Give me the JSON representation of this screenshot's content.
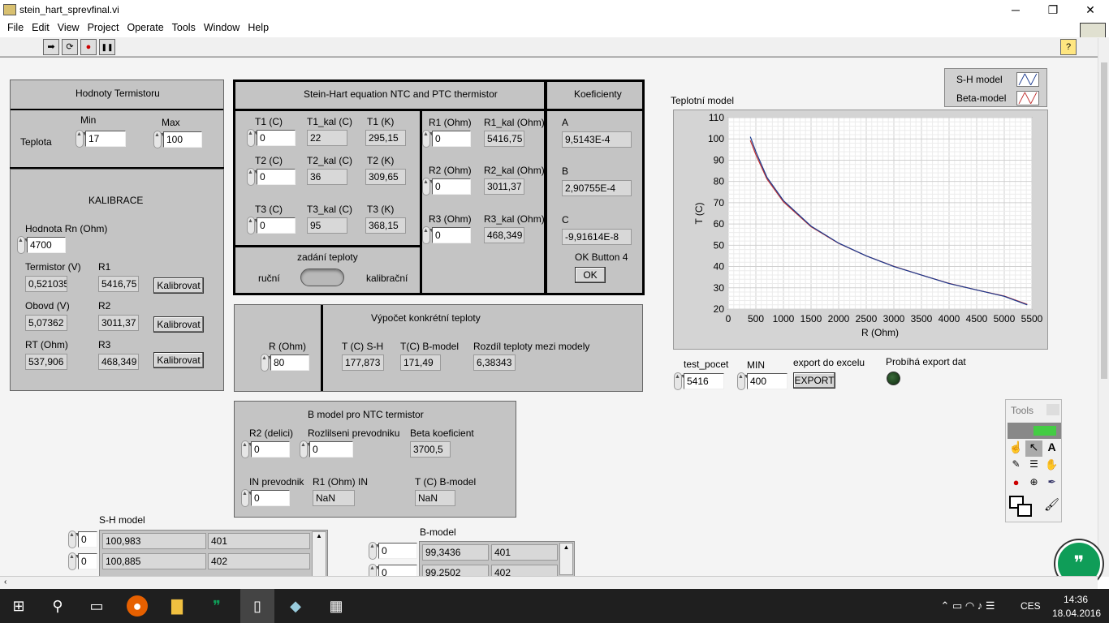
{
  "window": {
    "title": "stein_hart_sprevfinal.vi",
    "min": "─",
    "max": "❐",
    "close": "✕"
  },
  "menu": [
    "File",
    "Edit",
    "View",
    "Project",
    "Operate",
    "Tools",
    "Window",
    "Help"
  ],
  "toolbar": {
    "run": "➡",
    "run_cont": "⟳",
    "abort": "●",
    "pause": "❚❚",
    "help": "?"
  },
  "termistor": {
    "title": "Hodnoty Termistoru",
    "min_label": "Min",
    "max_label": "Max",
    "teplota_label": "Teplota",
    "min": "17",
    "max": "100"
  },
  "kalibrace": {
    "title": "KALIBRACE",
    "rn_label": "Hodnota Rn (Ohm)",
    "rn": "4700",
    "rows": [
      {
        "l1": "Termistor (V)",
        "v1": "0,521035",
        "l2": "R1",
        "v2": "5416,75",
        "btn": "Kalibrovat"
      },
      {
        "l1": "Obovd (V)",
        "v1": "5,07362",
        "l2": "R2",
        "v2": "3011,37",
        "btn": "Kalibrovat"
      },
      {
        "l1": "RT (Ohm)",
        "v1": "537,906",
        "l2": "R3",
        "v2": "468,349",
        "btn": "Kalibrovat"
      }
    ]
  },
  "stein": {
    "title": "Stein-Hart equation NTC and PTC thermistor",
    "rows": [
      {
        "tl": "T1 (C)",
        "tv": "0",
        "kl": "T1_kal (C)",
        "kv": "22",
        "ql": "T1 (K)",
        "qv": "295,15",
        "rl": "R1 (Ohm)",
        "rv": "0",
        "sl": "R1_kal (Ohm)",
        "sv": "5416,75"
      },
      {
        "tl": "T2 (C)",
        "tv": "0",
        "kl": "T2_kal (C)",
        "kv": "36",
        "ql": "T2 (K)",
        "qv": "309,65",
        "rl": "R2 (Ohm)",
        "rv": "0",
        "sl": "R2_kal (Ohm)",
        "sv": "3011,37"
      },
      {
        "tl": "T3 (C)",
        "tv": "0",
        "kl": "T3_kal (C)",
        "kv": "95",
        "ql": "T3 (K)",
        "qv": "368,15",
        "rl": "R3  (Ohm)",
        "rv": "0",
        "sl": "R3_kal (Ohm)",
        "sv": "468,349"
      }
    ],
    "zadani": "zadání teploty",
    "rucni": "ruční",
    "kalibracni": "kalibrační"
  },
  "koef": {
    "title": "Koeficienty",
    "a_label": "A",
    "a": "9,5143E-4",
    "b_label": "B",
    "b": "2,90755E-4",
    "c_label": "C",
    "c": "-9,91614E-8",
    "ok_label": "OK Button 4",
    "ok": "OK"
  },
  "vypocet": {
    "title": "Výpočet konkrétní teploty",
    "r_label": "R (Ohm)",
    "r": "80",
    "sh_label": "T (C) S-H",
    "sh": "177,873",
    "b_label": "T(C) B-model",
    "b": "171,49",
    "diff_label": "Rozdíl teploty mezi modely",
    "diff": "6,38343"
  },
  "bmodel": {
    "title": "B model pro NTC termistor",
    "r2_label": "R2 (delici)",
    "r2": "0",
    "rozl_label": "Rozlilseni prevodniku",
    "rozl": "0",
    "beta_label": "Beta koeficient",
    "beta": "3700,5",
    "in_label": "IN prevodnik",
    "in": "0",
    "r1in_label": "R1 (Ohm) IN",
    "r1in": "NaN",
    "tb_label": "T (C) B-model",
    "tb": "NaN"
  },
  "arrays": {
    "sh_label": "S-H model",
    "sh_idx": [
      "0",
      "0"
    ],
    "sh_rows": [
      [
        "100,983",
        "401"
      ],
      [
        "100,885",
        "402"
      ]
    ],
    "b_label": "B-model",
    "b_idx": [
      "0",
      "0"
    ],
    "b_rows": [
      [
        "99,3436",
        "401"
      ],
      [
        "99,2502",
        "402"
      ]
    ]
  },
  "export": {
    "test_label": "test_pocet",
    "test": "5416",
    "min_label": "MIN",
    "min": "400",
    "exp_label": "export  do excelu",
    "exp_btn": "EXPORT",
    "status_label": "Probíhá export dat"
  },
  "tools": {
    "title": "Tools"
  },
  "legend": [
    {
      "name": "S-H model"
    },
    {
      "name": "Beta-model"
    }
  ],
  "chart_data": {
    "type": "line",
    "title": "Teplotní model",
    "xlabel": "R (Ohm)",
    "ylabel": "T (C)",
    "xlim": [
      0,
      5500
    ],
    "ylim": [
      20,
      110
    ],
    "xticks": [
      "0",
      "500",
      "1000",
      "1500",
      "2000",
      "2500",
      "3000",
      "3500",
      "4000",
      "4500",
      "5000",
      "5500"
    ],
    "yticks": [
      "20",
      "30",
      "40",
      "50",
      "60",
      "70",
      "80",
      "90",
      "100",
      "110"
    ],
    "grid": true,
    "colors": {
      "sh": "#1a3a8f",
      "beta": "#c03030"
    },
    "series": [
      {
        "name": "S-H model",
        "x": [
          400,
          500,
          700,
          1000,
          1500,
          2000,
          2500,
          3000,
          3500,
          4000,
          4500,
          5000,
          5416
        ],
        "y": [
          101,
          94,
          82,
          71,
          59,
          51,
          45,
          40,
          36,
          32,
          29,
          26,
          22
        ]
      },
      {
        "name": "Beta-model",
        "x": [
          400,
          500,
          700,
          1000,
          1500,
          2000,
          2500,
          3000,
          3500,
          4000,
          4500,
          5000,
          5416
        ],
        "y": [
          99.3,
          92.6,
          81.2,
          70.4,
          58.7,
          50.9,
          45.0,
          40.1,
          36.0,
          32.1,
          29.0,
          26.1,
          22.2
        ]
      }
    ]
  },
  "taskbar": {
    "time": "14:36",
    "date": "18.04.2016",
    "lang": "CES"
  }
}
